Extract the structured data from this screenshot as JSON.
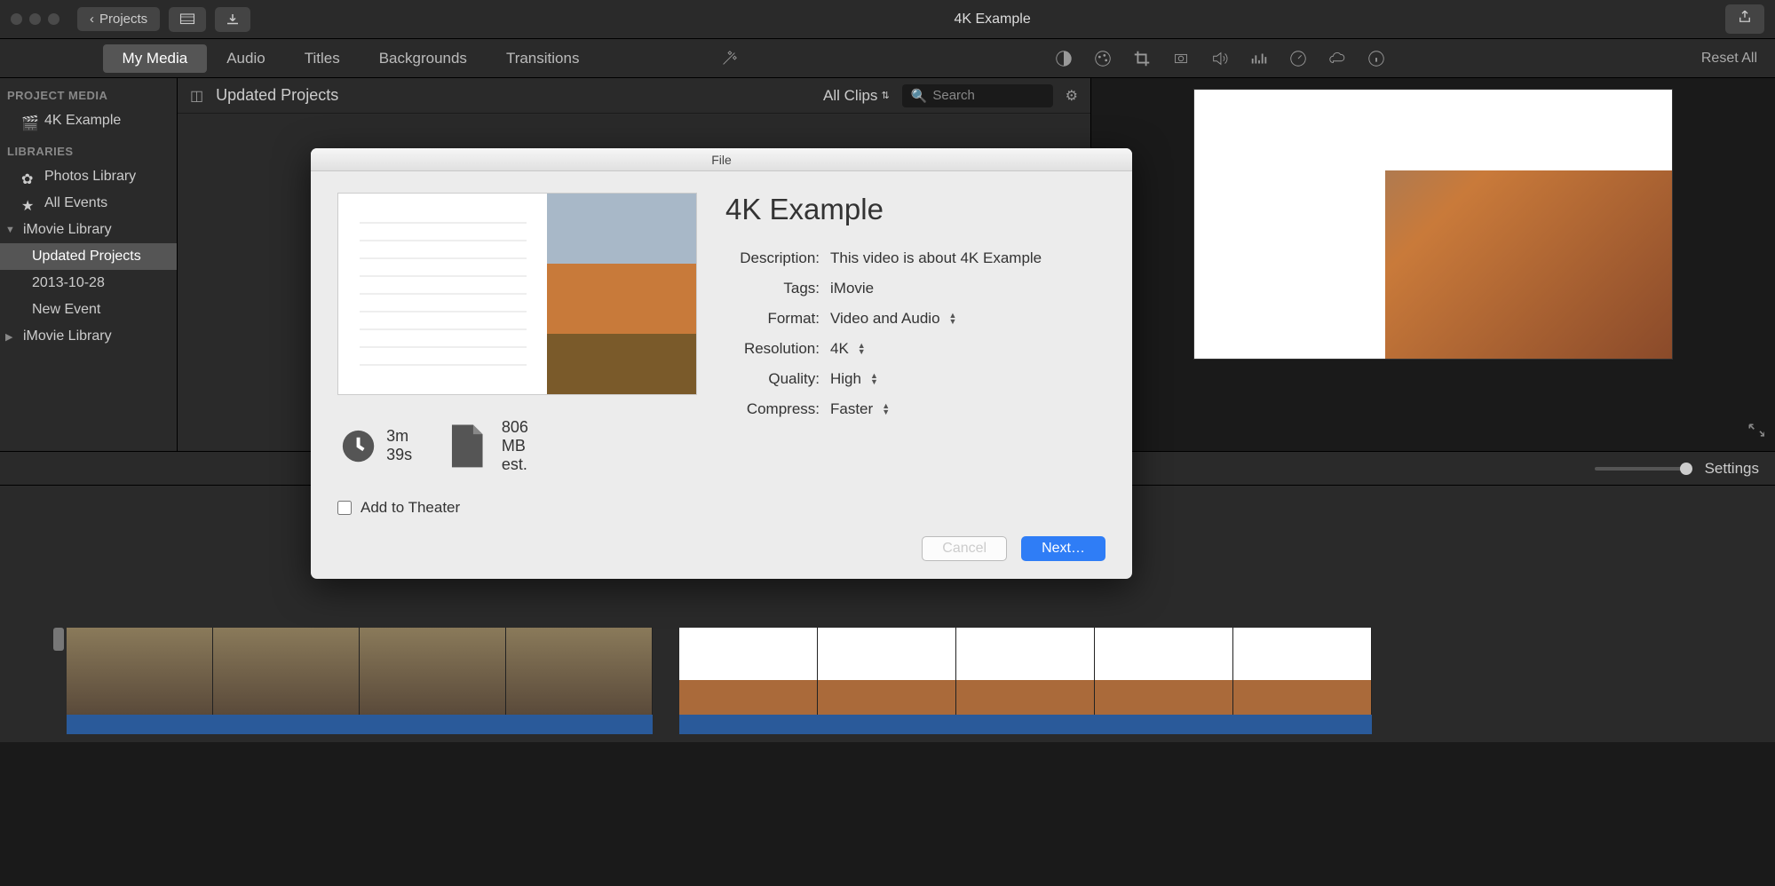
{
  "titlebar": {
    "project_title": "4K Example",
    "projects_btn": "Projects"
  },
  "tabs": {
    "my_media": "My Media",
    "audio": "Audio",
    "titles": "Titles",
    "backgrounds": "Backgrounds",
    "transitions": "Transitions",
    "reset_all": "Reset All"
  },
  "sidebar": {
    "project_media_header": "PROJECT MEDIA",
    "project_name": "4K Example",
    "libraries_header": "LIBRARIES",
    "items": [
      {
        "label": "Photos Library"
      },
      {
        "label": "All Events"
      },
      {
        "label": "iMovie Library"
      },
      {
        "label": "Updated Projects"
      },
      {
        "label": "2013-10-28"
      },
      {
        "label": "New Event"
      },
      {
        "label": "iMovie Library"
      }
    ]
  },
  "browser": {
    "title": "Updated Projects",
    "filter": "All Clips",
    "search_placeholder": "Search"
  },
  "settings": {
    "label": "Settings"
  },
  "dialog": {
    "titlebar": "File",
    "title": "4K Example",
    "labels": {
      "description": "Description:",
      "tags": "Tags:",
      "format": "Format:",
      "resolution": "Resolution:",
      "quality": "Quality:",
      "compress": "Compress:"
    },
    "values": {
      "description": "This video is about 4K Example",
      "tags": "iMovie",
      "format": "Video and Audio",
      "resolution": "4K",
      "quality": "High",
      "compress": "Faster"
    },
    "duration": "3m 39s",
    "filesize": "806 MB est.",
    "add_to_theater": "Add to Theater",
    "cancel": "Cancel",
    "next": "Next…"
  }
}
